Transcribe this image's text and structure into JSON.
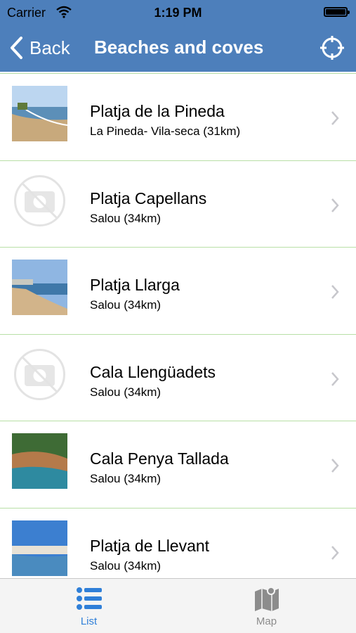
{
  "status": {
    "carrier": "Carrier",
    "time": "1:19 PM"
  },
  "nav": {
    "back_label": "Back",
    "title": "Beaches and coves"
  },
  "items": [
    {
      "title": "Platja de la Pineda",
      "subtitle": "La Pineda- Vila-seca (31km)",
      "image": "beach-photo"
    },
    {
      "title": "Platja Capellans",
      "subtitle": "Salou (34km)",
      "image": "no-photo-icon"
    },
    {
      "title": "Platja Llarga",
      "subtitle": "Salou (34km)",
      "image": "beach-photo"
    },
    {
      "title": "Cala Llengüadets",
      "subtitle": "Salou (34km)",
      "image": "no-photo-icon"
    },
    {
      "title": "Cala Penya Tallada",
      "subtitle": "Salou (34km)",
      "image": "cove-photo"
    },
    {
      "title": "Platja de Llevant",
      "subtitle": "Salou (34km)",
      "image": "beach-photo"
    }
  ],
  "tabs": [
    {
      "label": "List",
      "icon": "list-icon",
      "active": true
    },
    {
      "label": "Map",
      "icon": "map-icon",
      "active": false
    }
  ],
  "colors": {
    "navbar": "#4d7fbb",
    "tab_active": "#2f7fd8",
    "separator": "#b8dfa6"
  }
}
